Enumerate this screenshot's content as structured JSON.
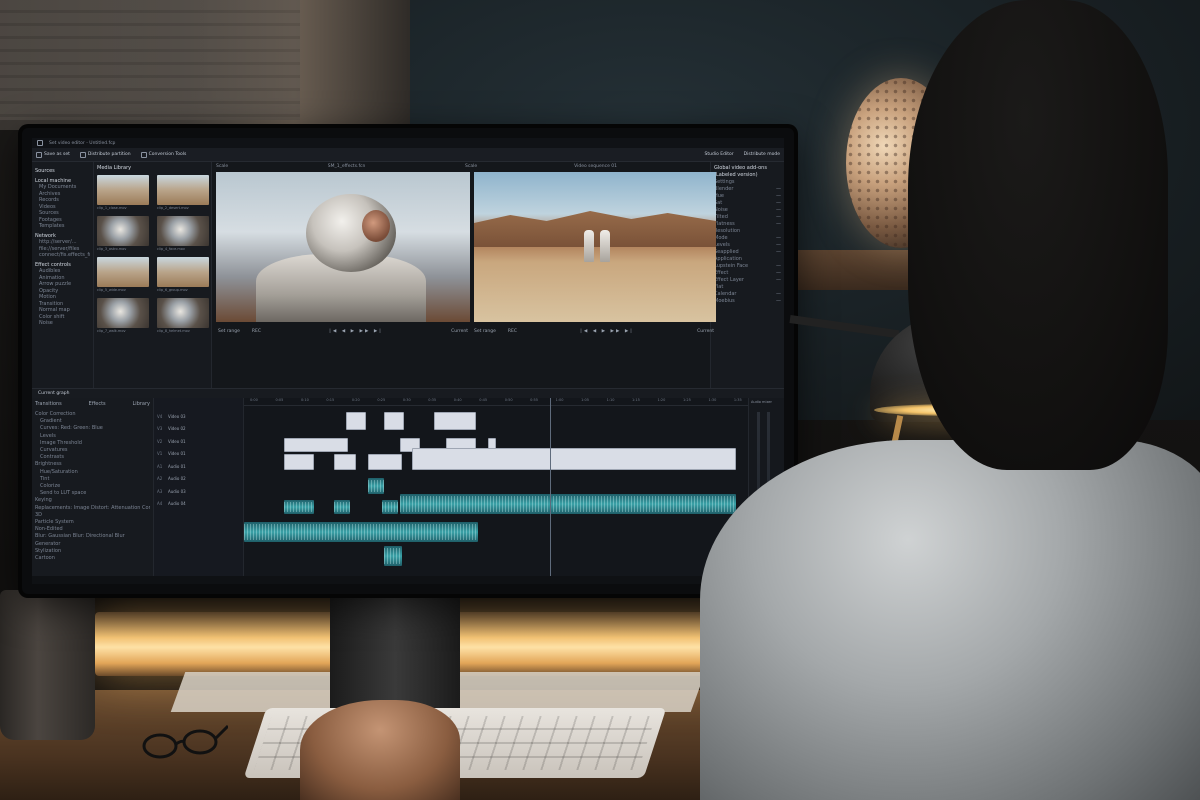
{
  "app": {
    "window_title": "Set video editor - Untitled.fcp",
    "toolbar": [
      "Save as set",
      "Distribute partition",
      "Conversion Tools"
    ],
    "toolbar_right": [
      "Studio Editor",
      "Distribute mode"
    ],
    "viewer_a_label": "SM_1_effects.fcn",
    "viewer_b_label": "Video sequence 01",
    "viewer_heads": [
      "Scale",
      "Scale"
    ],
    "set_range": "Set range",
    "timecode": "REC",
    "current": "Current"
  },
  "sources": {
    "header": "Sources",
    "local": "Local machine",
    "local_items": [
      "My Documents",
      "Archives",
      "Records",
      "Videos",
      "Sources",
      "Footages",
      "Templates"
    ],
    "network": "Network",
    "network_items": [
      "http://server/...",
      "file://server/files",
      "connect/fis.effects_fr"
    ],
    "effect_header": "Effect controls",
    "effect_items": [
      "Audibles",
      "Animation",
      "Arrow puzzle",
      "Opacity",
      "Motion",
      "Transition",
      "Normal map",
      "Color shift",
      "Noise"
    ]
  },
  "media_library": {
    "header": "Media Library",
    "thumbs": [
      "clip_1_close.mov",
      "clip_2_desert.mov",
      "clip_3_astro.mov",
      "clip_4_face.mov",
      "clip_5_wide.mov",
      "clip_6_group.mov",
      "clip_7_walk.mov",
      "clip_8_helmet.mov"
    ]
  },
  "properties": {
    "header": "Global video add-ons (Labeled version)",
    "rows": [
      "Settings",
      "Blender",
      "Hue",
      "Sat",
      "Noise",
      "Tilted",
      "Flatness",
      "Resolution",
      "Mode",
      "Levels",
      "Seapplied",
      "Application",
      "Lupstein Face",
      "Effect",
      "Effect Layer",
      "Flat",
      "Calendar",
      "Moebius"
    ]
  },
  "current_graph": "Current graph",
  "effects_panel": {
    "tabs": [
      "Transitions",
      "Effects",
      "Library"
    ],
    "items": [
      "Color Correction",
      "Gradient",
      "Curves: Red: Green: Blue",
      "Levels",
      "Image Threshold",
      "Curvatures",
      "Contrasts",
      "Brightness",
      "Hue/Saturation",
      "Tint",
      "Colorize",
      "Send to LUT space",
      "Keying",
      "Replacements: Image Distort: Attenuation Correct",
      "3D",
      "Particle System",
      "Non-Edited",
      "Blur: Gaussian Blur: Directional Blur",
      "Generator",
      "Stylization",
      "Cartoon"
    ]
  },
  "tracks": [
    {
      "tag": "V4",
      "name": "Video 03"
    },
    {
      "tag": "V3",
      "name": "Video 02"
    },
    {
      "tag": "V2",
      "name": "Video 01"
    },
    {
      "tag": "V1",
      "name": "Video 01"
    },
    {
      "tag": "A1",
      "name": "Audio 01"
    },
    {
      "tag": "A2",
      "name": "Audio 02"
    },
    {
      "tag": "A3",
      "name": "Audio 03"
    },
    {
      "tag": "A4",
      "name": "Audio 04"
    }
  ],
  "ruler": [
    "0:00",
    "0:05",
    "0:10",
    "0:15",
    "0:20",
    "0:25",
    "0:30",
    "0:35",
    "0:40",
    "0:45",
    "0:50",
    "0:55",
    "1:00",
    "1:05",
    "1:10",
    "1:15",
    "1:20",
    "1:25",
    "1:30",
    "1:35"
  ],
  "audio_panel": "Audio mixer"
}
